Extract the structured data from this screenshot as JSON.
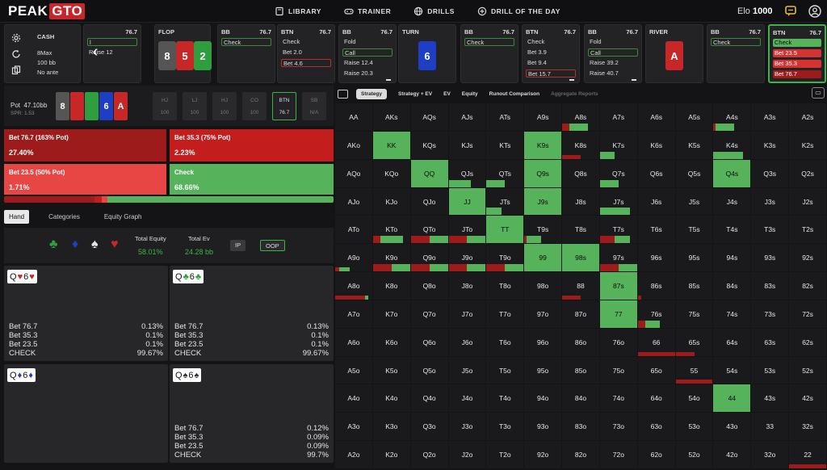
{
  "app": {
    "logo_a": "PEAK",
    "logo_b": "GTO"
  },
  "nav": [
    {
      "label": "LIBRARY",
      "icon": "book-icon"
    },
    {
      "label": "TRAINER",
      "icon": "gamepad-icon"
    },
    {
      "label": "DRILLS",
      "icon": "globe-icon"
    },
    {
      "label": "DRILL OF THE DAY",
      "icon": "plus-circle-icon"
    }
  ],
  "elo": {
    "label": "Elo",
    "value": "1000"
  },
  "game": {
    "type": "CASH",
    "format": "8Max",
    "stack": "100 bb",
    "ante": "No ante"
  },
  "history": [
    {
      "pos": "",
      "stack": "76.7",
      "actions": [
        {
          "label": "l",
          "style": "sel-g"
        },
        {
          "label": "Raise 12",
          "style": ""
        }
      ]
    },
    {
      "pos": "FLOP",
      "board": [
        {
          "r": "8",
          "c": "#555"
        },
        {
          "r": "5",
          "c": "#c62828"
        },
        {
          "r": "2",
          "c": "#2e9e3e"
        }
      ]
    },
    {
      "pos": "BB",
      "stack": "76.7",
      "actions": [
        {
          "label": "Check",
          "style": "sel-g"
        }
      ]
    },
    {
      "pos": "BTN",
      "stack": "76.7",
      "actions": [
        {
          "label": "Check",
          "style": ""
        },
        {
          "label": "Bet 2.0",
          "style": ""
        },
        {
          "label": "Bet 4.6",
          "style": "sel-r"
        }
      ]
    },
    {
      "pos": "BB",
      "stack": "76.7",
      "actions": [
        {
          "label": "Fold",
          "style": ""
        },
        {
          "label": "Call",
          "style": "sel-g"
        },
        {
          "label": "Raise 12.4",
          "style": ""
        },
        {
          "label": "Raise 20.3",
          "style": ""
        }
      ]
    },
    {
      "pos": "TURN",
      "board": [
        {
          "r": "6",
          "c": "#1e3fc4"
        }
      ]
    },
    {
      "pos": "BB",
      "stack": "76.7",
      "actions": [
        {
          "label": "Check",
          "style": "sel-g"
        }
      ]
    },
    {
      "pos": "BTN",
      "stack": "76.7",
      "actions": [
        {
          "label": "Check",
          "style": ""
        },
        {
          "label": "Bet 3.9",
          "style": ""
        },
        {
          "label": "Bet 9.4",
          "style": ""
        },
        {
          "label": "Bet 15.7",
          "style": "sel-r"
        }
      ]
    },
    {
      "pos": "BB",
      "stack": "76.7",
      "actions": [
        {
          "label": "Fold",
          "style": ""
        },
        {
          "label": "Call",
          "style": "sel-g"
        },
        {
          "label": "Raise 39.2",
          "style": ""
        },
        {
          "label": "Raise 40.7",
          "style": ""
        }
      ]
    },
    {
      "pos": "RIVER",
      "board": [
        {
          "r": "A",
          "c": "#c62828"
        }
      ]
    },
    {
      "pos": "BB",
      "stack": "76.7",
      "actions": [
        {
          "label": "Check",
          "style": "sel-g"
        }
      ]
    },
    {
      "pos": "BTN",
      "stack": "76.7",
      "active": true,
      "actions": [
        {
          "label": "Check",
          "style": "fill-g"
        },
        {
          "label": "Bet 23.5",
          "style": "fill-r"
        },
        {
          "label": "Bet 35.3",
          "style": "fill-r"
        },
        {
          "label": "Bet 76.7",
          "style": "fill-dr"
        }
      ]
    }
  ],
  "pot": {
    "label": "Pot",
    "value": "47.10bb",
    "spr": "SPR: 1.53"
  },
  "board": [
    {
      "r": "8",
      "c": "#555"
    },
    {
      "r": "",
      "c": "#c62828"
    },
    {
      "r": "",
      "c": "#2e9e3e"
    },
    {
      "r": "6",
      "c": "#1e3fc4"
    },
    {
      "r": "A",
      "c": "#c62828"
    }
  ],
  "seats": [
    {
      "pos": "HJ",
      "stack": "100",
      "on": false
    },
    {
      "pos": "LJ",
      "stack": "100",
      "on": false
    },
    {
      "pos": "HJ",
      "stack": "100",
      "on": false
    },
    {
      "pos": "CO",
      "stack": "100",
      "on": false
    },
    {
      "pos": "BTN",
      "stack": "76.7",
      "on": true
    },
    {
      "pos": "SB",
      "stack": "N/A",
      "on": false
    }
  ],
  "strategy": [
    {
      "label": "Bet 76.7 (163% Pot)",
      "value": "27.40%",
      "color": "#9e1b1b"
    },
    {
      "label": "Bet 35.3 (75% Pot)",
      "value": "2.23%",
      "color": "#c41d1d"
    },
    {
      "label": "Bet 23.5 (50% Pot)",
      "value": "1.71%",
      "color": "#e84545"
    },
    {
      "label": "Check",
      "value": "68.66%",
      "color": "#56b25b"
    }
  ],
  "freq": [
    {
      "pct": 27.4,
      "color": "#9e1b1b"
    },
    {
      "pct": 2.23,
      "color": "#c41d1d"
    },
    {
      "pct": 1.71,
      "color": "#e84545"
    },
    {
      "pct": 68.66,
      "color": "#56b25b"
    }
  ],
  "left_tabs": [
    "Hand",
    "Categories",
    "Equity Graph"
  ],
  "equity": {
    "label": "Total Equity",
    "value": "58.01%"
  },
  "ev": {
    "label": "Total Ev",
    "value": "24.28 bb"
  },
  "ip": "IP",
  "oop": "OOP",
  "combos": [
    {
      "r1": "Q",
      "s1": "♥",
      "r2": "6",
      "s2": "♥",
      "color": "#c62828",
      "rows": [
        [
          "Bet 76.7",
          "0.13%"
        ],
        [
          "Bet 35.3",
          "0.1%"
        ],
        [
          "Bet 23.5",
          "0.1%"
        ],
        [
          "CHECK",
          "99.67%"
        ]
      ]
    },
    {
      "r1": "Q",
      "s1": "♣",
      "r2": "6",
      "s2": "♣",
      "color": "#2e9e3e",
      "rows": [
        [
          "Bet 76.7",
          "0.13%"
        ],
        [
          "Bet 35.3",
          "0.1%"
        ],
        [
          "Bet 23.5",
          "0.1%"
        ],
        [
          "CHECK",
          "99.67%"
        ]
      ]
    },
    {
      "r1": "Q",
      "s1": "♦",
      "r2": "6",
      "s2": "♦",
      "color": "#1e3fc4",
      "rows": []
    },
    {
      "r1": "Q",
      "s1": "♠",
      "r2": "6",
      "s2": "♠",
      "color": "#333333",
      "rows": [
        [
          "Bet 76.7",
          "0.12%"
        ],
        [
          "Bet 35.3",
          "0.09%"
        ],
        [
          "Bet 23.5",
          "0.09%"
        ],
        [
          "CHECK",
          "99.7%"
        ]
      ]
    }
  ],
  "right_tabs": [
    {
      "label": "Strategy",
      "on": true,
      "dim": false
    },
    {
      "label": "Strategy + EV",
      "on": false,
      "dim": false
    },
    {
      "label": "EV",
      "on": false,
      "dim": false
    },
    {
      "label": "Equity",
      "on": false,
      "dim": false
    },
    {
      "label": "Runout Comparison",
      "on": false,
      "dim": false
    },
    {
      "label": "Aggregate Reports",
      "on": false,
      "dim": true
    }
  ],
  "colors": {
    "check": "#56b25b",
    "bet_small": "#e84545",
    "bet_mid": "#c41d1d",
    "bet_big": "#9e1b1b"
  },
  "ranks": [
    "A",
    "K",
    "Q",
    "J",
    "T",
    "9",
    "8",
    "7",
    "6",
    "5",
    "4",
    "3",
    "2"
  ],
  "matrix_fills": {
    "AKs": [
      0,
      0,
      0,
      0
    ],
    "A8s": [
      0.2,
      0,
      0,
      0.5
    ],
    "A4s": [
      0.05,
      0,
      0,
      0.5
    ],
    "KK": [
      0,
      0,
      0,
      1
    ],
    "K9s": [
      0,
      0,
      0,
      1
    ],
    "K8s": [
      0.5,
      0,
      0,
      0
    ],
    "K7s": [
      0,
      0,
      0,
      0.4
    ],
    "K4s": [
      0,
      0,
      0,
      0.8
    ],
    "QQ": [
      0,
      0,
      0,
      1
    ],
    "QJs": [
      0,
      0,
      0,
      0.6
    ],
    "QTs": [
      0,
      0,
      0,
      0.5
    ],
    "Q9s": [
      0,
      0,
      0,
      1
    ],
    "Q7s": [
      0,
      0,
      0,
      0.5
    ],
    "Q4s": [
      0,
      0,
      0,
      1
    ],
    "JJ": [
      0,
      0,
      0,
      1
    ],
    "JTs": [
      0,
      0,
      0,
      0.4
    ],
    "J9s": [
      0,
      0,
      0,
      1
    ],
    "J7s": [
      0,
      0,
      0,
      0.8
    ],
    "KTo": [
      0.2,
      0,
      0,
      0.6
    ],
    "QTo": [
      0.5,
      0,
      0,
      0.5
    ],
    "JTo": [
      0.5,
      0,
      0,
      0.5
    ],
    "TT": [
      0,
      0,
      0,
      1
    ],
    "T9s": [
      0.05,
      0,
      0,
      0.4
    ],
    "T7s": [
      0.4,
      0,
      0,
      0.4
    ],
    "A9o": [
      0.1,
      0,
      0,
      0.3
    ],
    "K9o": [
      0.5,
      0,
      0,
      0.5
    ],
    "Q9o": [
      0.5,
      0,
      0,
      0.5
    ],
    "J9o": [
      0.5,
      0,
      0,
      0.5
    ],
    "T9o": [
      0.5,
      0,
      0,
      0.5
    ],
    "99": [
      0,
      0,
      0,
      1
    ],
    "98s": [
      0,
      0,
      0,
      1
    ],
    "97s": [
      0.5,
      0,
      0,
      0.5
    ],
    "A8o": [
      0.8,
      0,
      0,
      0.1
    ],
    "88": [
      0.5,
      0,
      0,
      0
    ],
    "87s": [
      0,
      0,
      0,
      1
    ],
    "86s": [
      0.1,
      0,
      0,
      0
    ],
    "77": [
      0,
      0,
      0,
      1
    ],
    "76s": [
      0.2,
      0,
      0,
      0.4
    ],
    "66": [
      1,
      0,
      0,
      0
    ],
    "65s": [
      0.5,
      0,
      0,
      0
    ],
    "55": [
      1,
      0,
      0,
      0
    ],
    "44": [
      0,
      0,
      0,
      1
    ],
    "22": [
      1,
      0,
      0,
      0
    ]
  }
}
